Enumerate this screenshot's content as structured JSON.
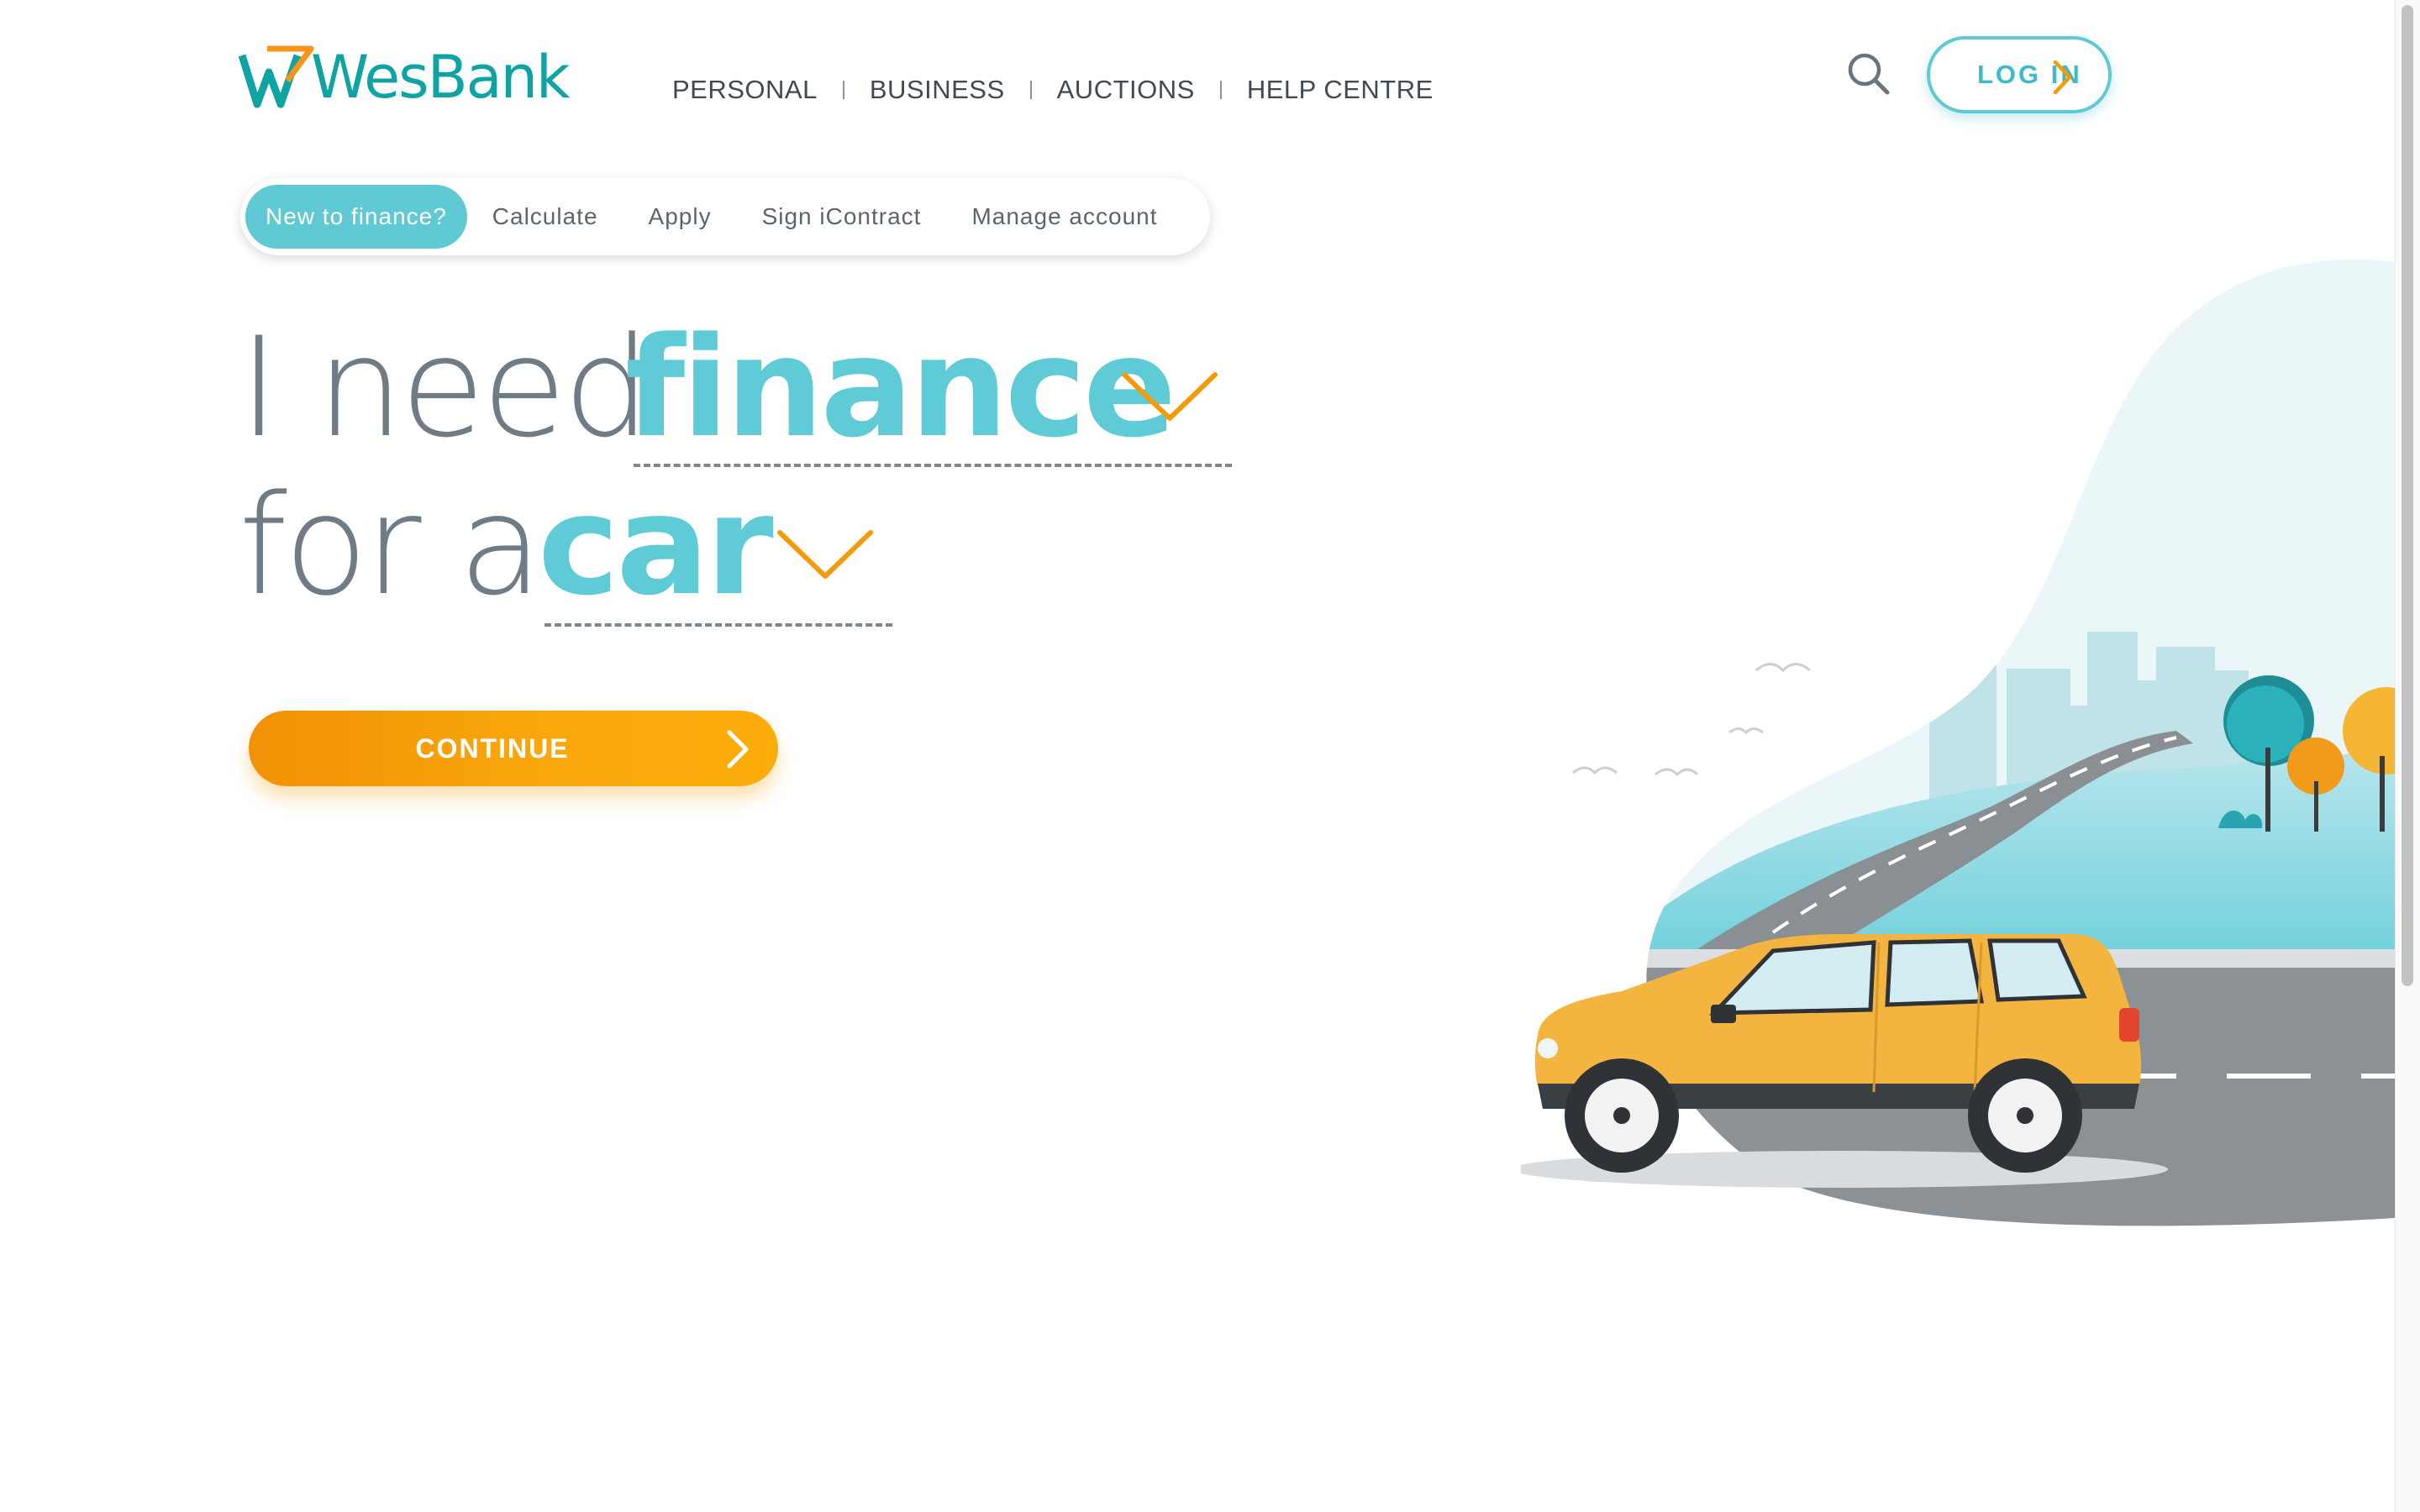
{
  "logo": {
    "text": "WesBank"
  },
  "top_nav": {
    "items": [
      {
        "label": "PERSONAL"
      },
      {
        "label": "BUSINESS"
      },
      {
        "label": "AUCTIONS"
      },
      {
        "label": "HELP CENTRE"
      }
    ]
  },
  "header": {
    "search_icon": "search-icon",
    "login_label": "LOG IN"
  },
  "sub_nav": {
    "items": [
      {
        "label": "New to finance?",
        "active": true
      },
      {
        "label": "Calculate"
      },
      {
        "label": "Apply"
      },
      {
        "label": "Sign iContract"
      },
      {
        "label": "Manage account"
      }
    ]
  },
  "hero": {
    "line1_prefix": "I need",
    "line1_selection": "finance",
    "line2_prefix": "for a",
    "line2_selection": "car"
  },
  "cta": {
    "continue_label": "CONTINUE"
  },
  "colors": {
    "brand_teal": "#5ecbd6",
    "brand_orange": "#f59b0a",
    "text_gray": "#6f7c86",
    "car_yellow": "#f3b540"
  }
}
